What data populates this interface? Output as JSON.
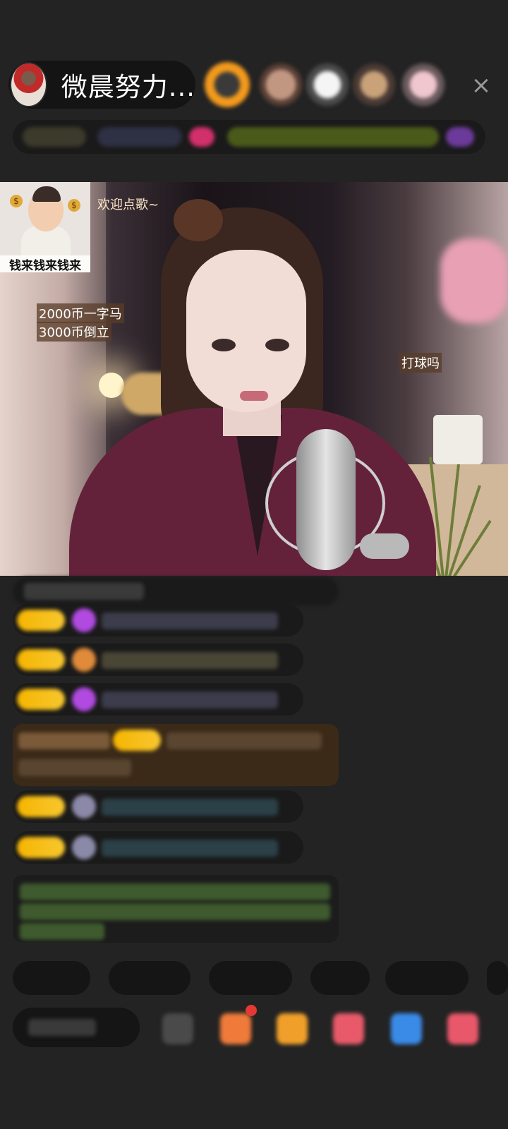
{
  "header": {
    "host_name": "微晨努力...",
    "close_glyph": "×"
  },
  "video": {
    "sticker_caption": "钱来钱来钱来",
    "coin_glyph": "$",
    "welcome_text": "欢迎点歌~",
    "price_line_1": "2000币一字马",
    "price_line_2": "3000币倒立",
    "right_tag": "打球吗"
  },
  "colors": {
    "badge_gold": "#f6b500",
    "gift_row_bg": "#3b2a18",
    "chat_bg": "#1a1a1a"
  }
}
